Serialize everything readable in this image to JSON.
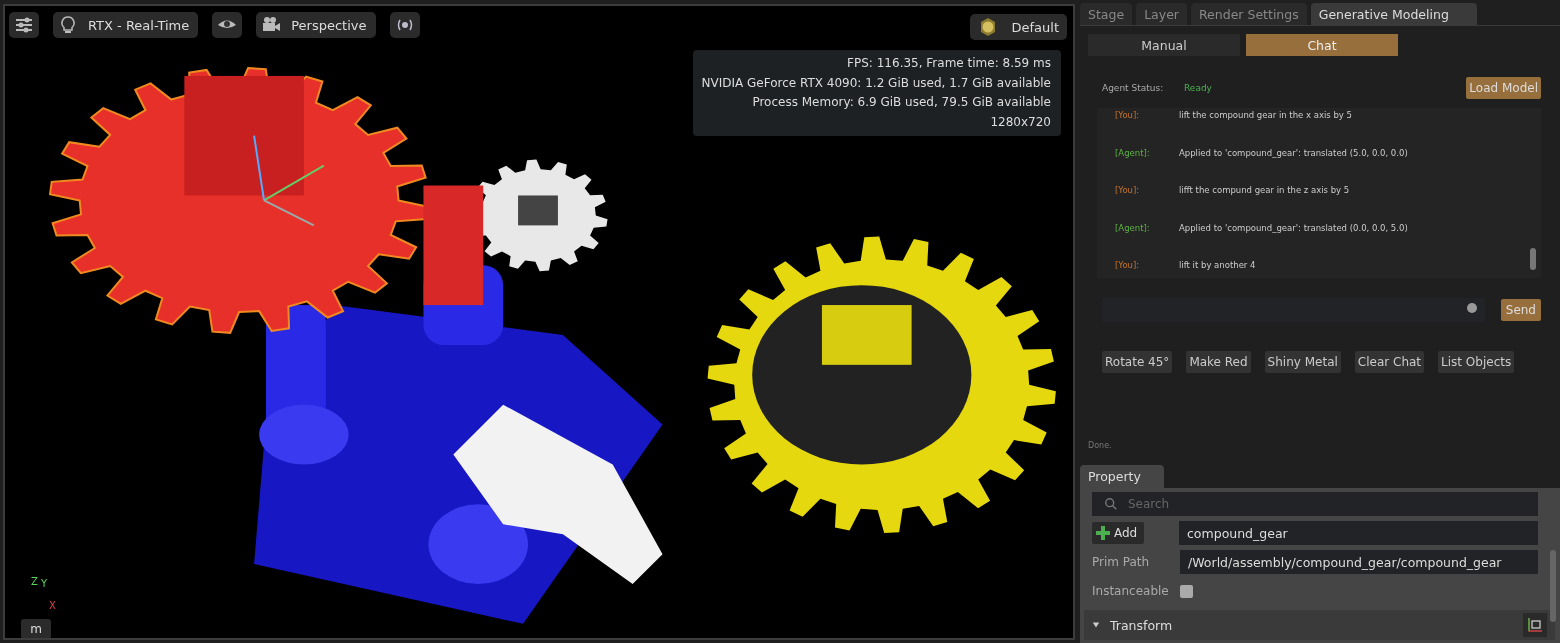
{
  "viewport": {
    "toolbar": [
      {
        "kind": "settings"
      },
      {
        "kind": "light",
        "label": "RTX - Real-Time"
      },
      {
        "kind": "eye"
      },
      {
        "kind": "camera",
        "label": "Perspective"
      },
      {
        "kind": "broadcast"
      }
    ],
    "lighting": {
      "label": "Default"
    },
    "stats": [
      "FPS: 116.35, Frame time: 8.59 ms",
      "NVIDIA GeForce RTX 4090: 1.2 GiB used, 1.7 GiB available",
      "Process Memory: 6.9 GiB used, 79.5 GiB available",
      "1280x720"
    ],
    "axis_labels": [
      "Z",
      "Y",
      "X"
    ],
    "unit_button": "m"
  },
  "tabs": [
    {
      "label": "Stage",
      "selected": false
    },
    {
      "label": "Layer",
      "selected": false
    },
    {
      "label": "Render Settings",
      "selected": false
    },
    {
      "label": "Generative Modeling",
      "selected": true
    }
  ],
  "mode_tabs": [
    {
      "label": "Manual",
      "selected": false
    },
    {
      "label": "Chat",
      "selected": true
    }
  ],
  "agent_status": {
    "label": "Agent Status:",
    "value": "Ready"
  },
  "load_model_button": "Load Model",
  "chat": [
    {
      "kind": "user",
      "speaker": "[You]:",
      "text": "lift the compound gear in the x axis by 5"
    },
    {
      "kind": "agent",
      "speaker": "[Agent]:",
      "text": "Applied to 'compound_gear': translated (5.0, 0.0, 0.0)"
    },
    {
      "kind": "user",
      "speaker": "[You]:",
      "text": "lifft the compund gear in the z axis by 5"
    },
    {
      "kind": "agent",
      "speaker": "[Agent]:",
      "text": "Applied to 'compound_gear': translated (0.0, 0.0, 5.0)"
    },
    {
      "kind": "user",
      "speaker": "[You]:",
      "text": "lift it by another 4"
    }
  ],
  "send_button": "Send",
  "quick_actions": [
    "Rotate 45°",
    "Make Red",
    "Shiny Metal",
    "Clear Chat",
    "List Objects"
  ],
  "status_text": "Done.",
  "property": {
    "tab": "Property",
    "search_placeholder": "Search",
    "add_button": "Add",
    "name_value": "compound_gear",
    "prim_path": {
      "label": "Prim Path",
      "value": "/World/assembly/compound_gear/compound_gear"
    },
    "instanceable": {
      "label": "Instanceable",
      "checked": false
    },
    "section": {
      "label": "Transform",
      "expanded": true
    }
  }
}
